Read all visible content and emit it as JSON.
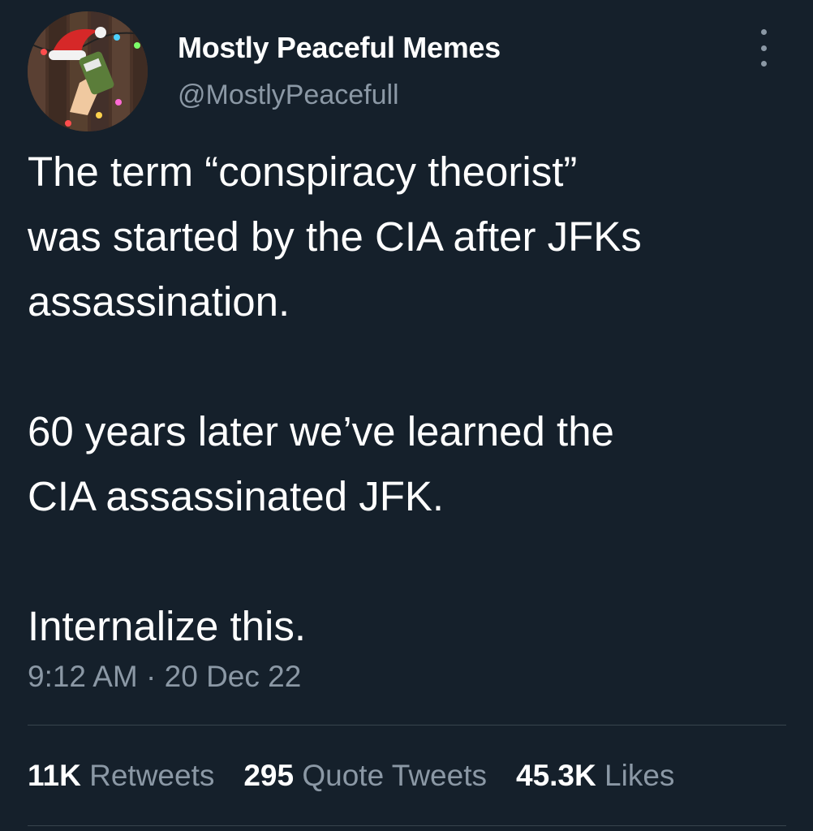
{
  "author": {
    "display_name": "Mostly Peaceful Memes",
    "handle": "@MostlyPeacefull"
  },
  "tweet": {
    "paragraphs": [
      "The term “conspiracy theorist”\nwas started by the CIA after JFKs\nassassination.",
      "60 years later we’ve learned the\nCIA assassinated JFK.",
      "Internalize this."
    ],
    "timestamp": "9:12 AM · 20 Dec 22"
  },
  "stats": {
    "retweets": {
      "count": "11K",
      "label": "Retweets"
    },
    "quote_tweets": {
      "count": "295",
      "label": "Quote Tweets"
    },
    "likes": {
      "count": "45.3K",
      "label": "Likes"
    }
  },
  "icons": {
    "more": "more-vertical-icon",
    "avatar": "avatar-image"
  },
  "colors": {
    "background": "#15202b",
    "primary_text": "#ffffff",
    "secondary_text": "#8b98a5",
    "divider": "#38444d"
  }
}
